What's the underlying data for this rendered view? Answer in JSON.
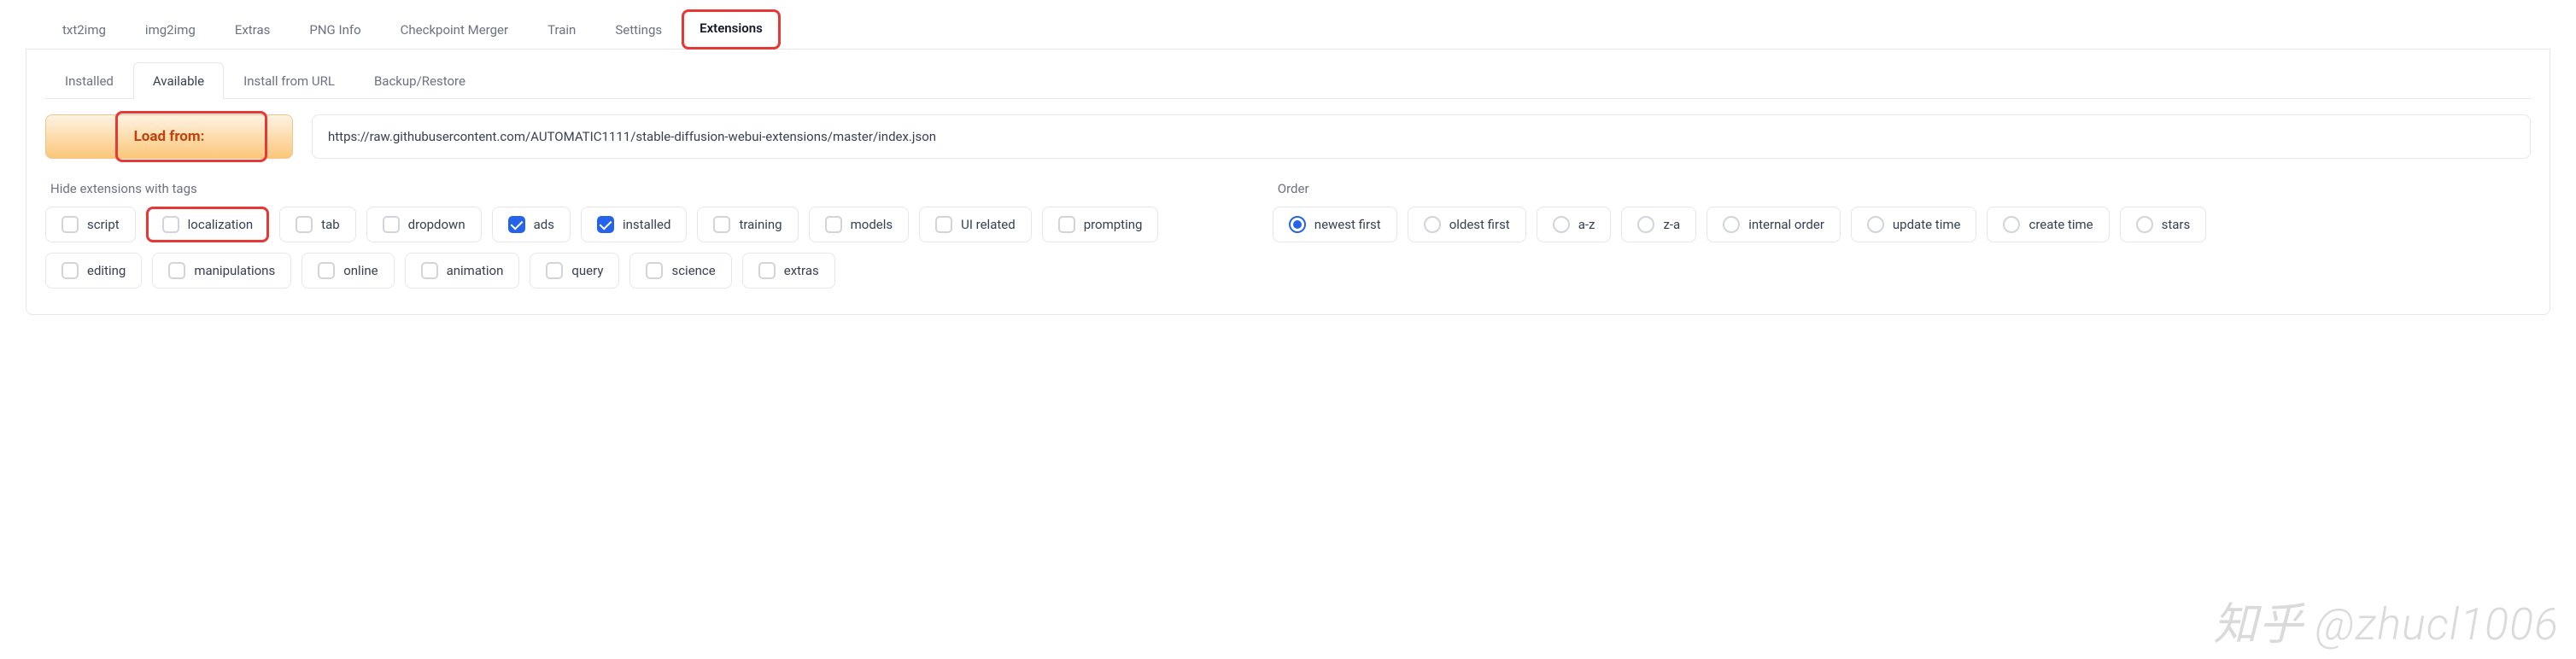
{
  "top_tabs": {
    "items": [
      {
        "label": "txt2img"
      },
      {
        "label": "img2img"
      },
      {
        "label": "Extras"
      },
      {
        "label": "PNG Info"
      },
      {
        "label": "Checkpoint Merger"
      },
      {
        "label": "Train"
      },
      {
        "label": "Settings"
      },
      {
        "label": "Extensions"
      }
    ],
    "active_index": 7,
    "highlighted_index": 7
  },
  "sub_tabs": {
    "items": [
      {
        "label": "Installed"
      },
      {
        "label": "Available"
      },
      {
        "label": "Install from URL"
      },
      {
        "label": "Backup/Restore"
      }
    ],
    "active_index": 1
  },
  "load": {
    "button_label": "Load from:",
    "url": "https://raw.githubusercontent.com/AUTOMATIC1111/stable-diffusion-webui-extensions/master/index.json",
    "highlighted": true
  },
  "tags": {
    "label": "Hide extensions with tags",
    "items": [
      {
        "label": "script",
        "checked": false
      },
      {
        "label": "localization",
        "checked": false,
        "highlighted": true
      },
      {
        "label": "tab",
        "checked": false
      },
      {
        "label": "dropdown",
        "checked": false
      },
      {
        "label": "ads",
        "checked": true
      },
      {
        "label": "installed",
        "checked": true
      },
      {
        "label": "training",
        "checked": false
      },
      {
        "label": "models",
        "checked": false
      },
      {
        "label": "UI related",
        "checked": false
      },
      {
        "label": "prompting",
        "checked": false
      },
      {
        "label": "editing",
        "checked": false
      },
      {
        "label": "manipulations",
        "checked": false
      },
      {
        "label": "online",
        "checked": false
      },
      {
        "label": "animation",
        "checked": false
      },
      {
        "label": "query",
        "checked": false
      },
      {
        "label": "science",
        "checked": false
      },
      {
        "label": "extras",
        "checked": false
      }
    ]
  },
  "order": {
    "label": "Order",
    "items": [
      {
        "label": "newest first",
        "checked": true
      },
      {
        "label": "oldest first",
        "checked": false
      },
      {
        "label": "a-z",
        "checked": false
      },
      {
        "label": "z-a",
        "checked": false
      },
      {
        "label": "internal order",
        "checked": false
      },
      {
        "label": "update time",
        "checked": false
      },
      {
        "label": "create time",
        "checked": false
      },
      {
        "label": "stars",
        "checked": false
      }
    ]
  },
  "watermark": "知乎 @zhucl1006"
}
